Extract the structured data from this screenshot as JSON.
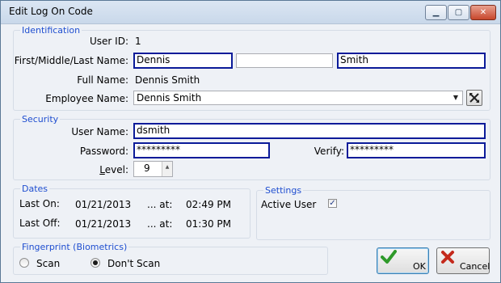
{
  "window": {
    "title": "Edit Log On Code",
    "controls": [
      "minimize",
      "maximize",
      "close"
    ]
  },
  "identification": {
    "group_title": "Identification",
    "user_id_label": "User ID:",
    "user_id_value": "1",
    "name_label": "First/Middle/Last Name:",
    "first_name": "Dennis",
    "middle_name": "",
    "last_name": "Smith",
    "full_name_label": "Full Name:",
    "full_name_value": "Dennis Smith",
    "employee_name_label": "Employee Name:",
    "employee_name_value": "Dennis Smith"
  },
  "security": {
    "group_title": "Security",
    "user_name_label": "User Name:",
    "user_name_value": "dsmith",
    "password_label": "Password:",
    "password_value": "*********",
    "verify_label": "Verify:",
    "verify_value": "*********",
    "level_label": "Level:",
    "level_mnemonic": "L",
    "level_rest": "evel:",
    "level_value": "9"
  },
  "dates": {
    "group_title": "Dates",
    "last_on_label": "Last On:",
    "last_on_date": "01/21/2013",
    "last_on_at": "... at:",
    "last_on_time": "02:49 PM",
    "last_off_label": "Last Off:",
    "last_off_date": "01/21/2013",
    "last_off_at": "... at:",
    "last_off_time": "01:30 PM"
  },
  "settings": {
    "group_title": "Settings",
    "active_user_label": "Active User",
    "active_user_checked": true
  },
  "fingerprint": {
    "group_title": "Fingerprint (Biometrics)",
    "scan_label": "Scan",
    "dont_scan_label": "Don't Scan",
    "selected": "dont_scan"
  },
  "buttons": {
    "ok_label": "OK",
    "cancel_label": "Cancel"
  },
  "colors": {
    "group_title": "#1f4ed0",
    "highlight_border": "#0b1b99",
    "ok_icon": "#2f9a2a",
    "cancel_icon": "#c42a1c"
  },
  "icons": {
    "employee_lookup": "cross-arrows-icon",
    "ok": "checkmark-icon",
    "cancel": "x-mark-icon"
  }
}
